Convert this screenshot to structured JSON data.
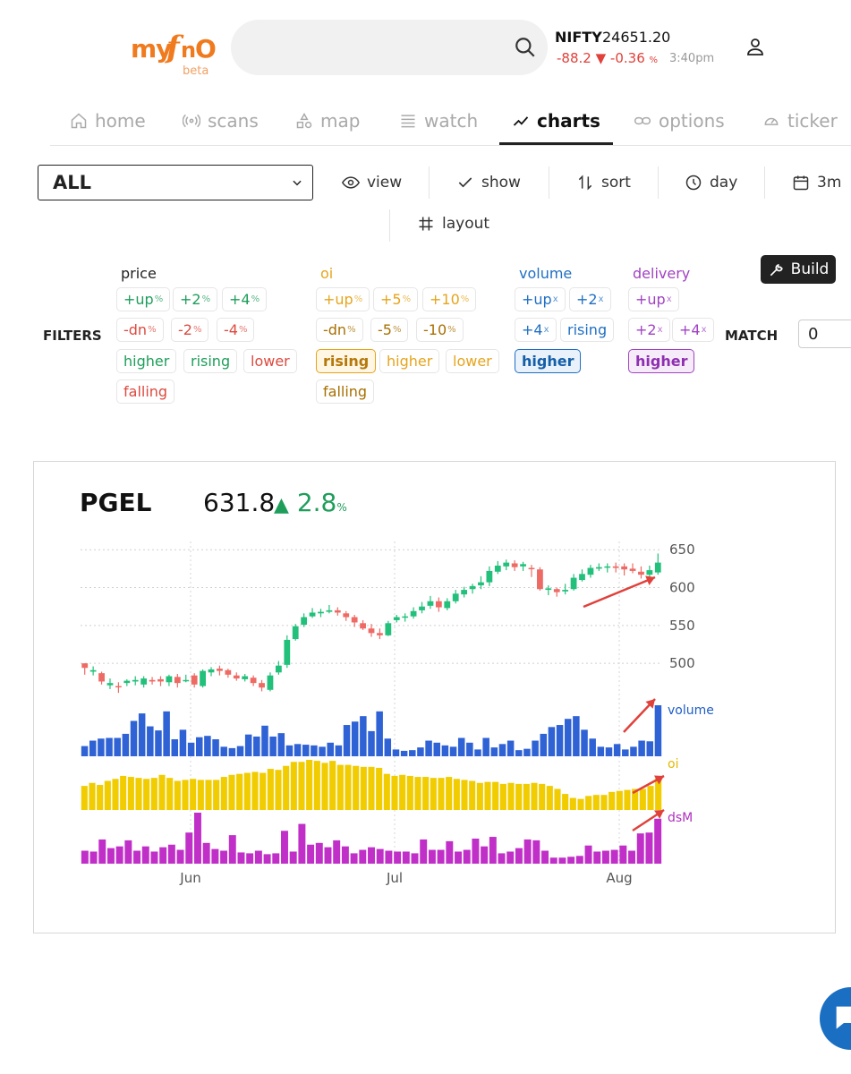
{
  "app": {
    "logo_text": "myfnO",
    "beta": "beta",
    "accent": "#f07a1e"
  },
  "index": {
    "name": "NIFTY",
    "value": "24651.20",
    "change": "-88.2",
    "change_pct": "-0.36",
    "pct_sign": "%",
    "time": "3:40pm"
  },
  "nav": {
    "tabs": [
      {
        "label": "home",
        "icon": "home-icon"
      },
      {
        "label": "scans",
        "icon": "broadcast-icon"
      },
      {
        "label": "map",
        "icon": "shapes-icon"
      },
      {
        "label": "watch",
        "icon": "list-icon"
      },
      {
        "label": "charts",
        "icon": "trend-icon",
        "active": true
      },
      {
        "label": "options",
        "icon": "link-icon"
      },
      {
        "label": "ticker",
        "icon": "gauge-icon"
      }
    ]
  },
  "toolbar": {
    "select_value": "ALL",
    "view": "view",
    "show": "show",
    "sort": "sort",
    "period": "day",
    "range": "3m",
    "layout": "layout"
  },
  "filters": {
    "label": "FILTERS",
    "match_label": "MATCH",
    "match_value": "0",
    "build": "Build",
    "price": {
      "head": "price",
      "chips": [
        "+up",
        "+2",
        "+4",
        "-dn",
        "-2",
        "-4",
        "higher",
        "rising",
        "lower",
        "falling"
      ]
    },
    "oi": {
      "head": "oi",
      "chips": [
        "+up",
        "+5",
        "+10",
        "-dn",
        "-5",
        "-10",
        "rising",
        "higher",
        "lower",
        "falling"
      ]
    },
    "volume": {
      "head": "volume",
      "chips": [
        "+up",
        "+2",
        "+4",
        "rising",
        "higher"
      ]
    },
    "delivery": {
      "head": "delivery",
      "chips": [
        "+up",
        "+2",
        "+4",
        "higher"
      ]
    },
    "units": {
      "pct": "%",
      "x": "x"
    }
  },
  "stock": {
    "symbol": "PGEL",
    "price": "631.8",
    "change": "2.8",
    "pct": "%"
  },
  "chart_data": {
    "type": "candlestick",
    "y_ticks": [
      650,
      600,
      550,
      500
    ],
    "ylim": [
      460,
      655
    ],
    "x_ticks": [
      "Jun",
      "Jul",
      "Aug"
    ],
    "panel_labels": [
      "volume",
      "oi",
      "dsM"
    ],
    "colors": {
      "up": "#22c07a",
      "down": "#ee6a64",
      "volume": "#2f62d4",
      "oi": "#f0cc00",
      "delivery": "#c030c8",
      "arrow": "#e0413b"
    },
    "candles": [
      [
        500,
        494,
        500,
        485
      ],
      [
        489,
        491,
        496,
        484
      ],
      [
        487,
        476,
        489,
        472
      ],
      [
        471,
        474,
        480,
        466
      ],
      [
        470,
        469,
        475,
        461
      ],
      [
        474,
        477,
        479,
        470
      ],
      [
        476,
        478,
        483,
        471
      ],
      [
        472,
        480,
        483,
        468
      ],
      [
        478,
        476,
        482,
        472
      ],
      [
        479,
        476,
        483,
        470
      ],
      [
        475,
        483,
        485,
        470
      ],
      [
        482,
        474,
        486,
        468
      ],
      [
        477,
        478,
        485,
        475
      ],
      [
        484,
        472,
        487,
        468
      ],
      [
        470,
        490,
        492,
        468
      ],
      [
        488,
        492,
        495,
        483
      ],
      [
        493,
        490,
        497,
        484
      ],
      [
        491,
        485,
        493,
        481
      ],
      [
        484,
        480,
        488,
        477
      ],
      [
        479,
        483,
        486,
        476
      ],
      [
        481,
        474,
        484,
        470
      ],
      [
        474,
        468,
        478,
        463
      ],
      [
        465,
        484,
        488,
        463
      ],
      [
        488,
        497,
        503,
        485
      ],
      [
        498,
        531,
        537,
        494
      ],
      [
        532,
        549,
        552,
        530
      ],
      [
        551,
        561,
        566,
        548
      ],
      [
        562,
        567,
        573,
        560
      ],
      [
        566,
        568,
        572,
        561
      ],
      [
        568,
        570,
        577,
        566
      ],
      [
        570,
        567,
        574,
        563
      ],
      [
        566,
        561,
        569,
        556
      ],
      [
        561,
        554,
        564,
        548
      ],
      [
        553,
        546,
        557,
        544
      ],
      [
        546,
        540,
        552,
        535
      ],
      [
        540,
        537,
        546,
        532
      ],
      [
        537,
        553,
        556,
        536
      ],
      [
        557,
        561,
        564,
        554
      ],
      [
        561,
        562,
        566,
        555
      ],
      [
        562,
        569,
        574,
        559
      ],
      [
        570,
        575,
        581,
        566
      ],
      [
        576,
        582,
        589,
        572
      ],
      [
        582,
        574,
        587,
        568
      ],
      [
        573,
        582,
        586,
        570
      ],
      [
        582,
        592,
        597,
        579
      ],
      [
        591,
        597,
        601,
        587
      ],
      [
        598,
        602,
        605,
        592
      ],
      [
        603,
        607,
        615,
        598
      ],
      [
        607,
        622,
        628,
        602
      ],
      [
        621,
        629,
        635,
        618
      ],
      [
        628,
        633,
        637,
        623
      ],
      [
        632,
        627,
        636,
        622
      ],
      [
        628,
        631,
        634,
        622
      ],
      [
        626,
        625,
        630,
        614
      ],
      [
        624,
        598,
        627,
        596
      ],
      [
        597,
        599,
        603,
        590
      ],
      [
        598,
        594,
        600,
        588
      ],
      [
        595,
        597,
        605,
        591
      ],
      [
        598,
        613,
        618,
        596
      ],
      [
        610,
        618,
        624,
        608
      ],
      [
        617,
        626,
        630,
        613
      ],
      [
        625,
        627,
        632,
        622
      ],
      [
        628,
        628,
        632,
        620
      ],
      [
        628,
        626,
        633,
        620
      ],
      [
        628,
        624,
        632,
        616
      ],
      [
        625,
        622,
        632,
        619
      ],
      [
        621,
        617,
        628,
        612
      ],
      [
        617,
        623,
        629,
        612
      ],
      [
        620,
        633,
        645,
        617
      ]
    ],
    "volume": [
      15,
      23,
      26,
      27,
      27,
      33,
      52,
      63,
      44,
      38,
      66,
      25,
      39,
      20,
      28,
      30,
      25,
      14,
      12,
      15,
      32,
      29,
      45,
      29,
      34,
      16,
      18,
      17,
      16,
      14,
      20,
      16,
      46,
      51,
      59,
      37,
      66,
      26,
      10,
      8,
      9,
      13,
      23,
      20,
      16,
      14,
      27,
      20,
      10,
      27,
      13,
      18,
      23,
      9,
      11,
      23,
      33,
      43,
      46,
      55,
      59,
      39,
      26,
      14,
      13,
      18,
      10,
      14,
      23,
      22,
      75
    ],
    "oi": [
      24,
      27,
      25,
      29,
      31,
      34,
      33,
      32,
      31,
      32,
      35,
      32,
      29,
      30,
      31,
      30,
      30,
      30,
      33,
      35,
      36,
      37,
      38,
      37,
      41,
      40,
      44,
      48,
      48,
      50,
      49,
      47,
      49,
      45,
      45,
      44,
      43,
      43,
      42,
      36,
      34,
      35,
      34,
      33,
      33,
      32,
      32,
      33,
      31,
      30,
      29,
      27,
      28,
      28,
      26,
      27,
      26,
      26,
      27,
      26,
      24,
      21,
      16,
      12,
      11,
      14,
      15,
      15,
      18,
      19,
      20,
      21,
      21,
      24,
      32
    ],
    "delivery": [
      15,
      14,
      28,
      18,
      20,
      27,
      15,
      20,
      14,
      19,
      22,
      16,
      36,
      59,
      24,
      17,
      15,
      33,
      13,
      12,
      15,
      11,
      12,
      38,
      14,
      46,
      22,
      24,
      19,
      27,
      20,
      12,
      16,
      19,
      17,
      15,
      14,
      14,
      12,
      28,
      16,
      16,
      26,
      14,
      16,
      29,
      20,
      31,
      12,
      14,
      18,
      28,
      27,
      15,
      7,
      7,
      8,
      9,
      21,
      14,
      15,
      16,
      21,
      15,
      35,
      36,
      52
    ]
  }
}
